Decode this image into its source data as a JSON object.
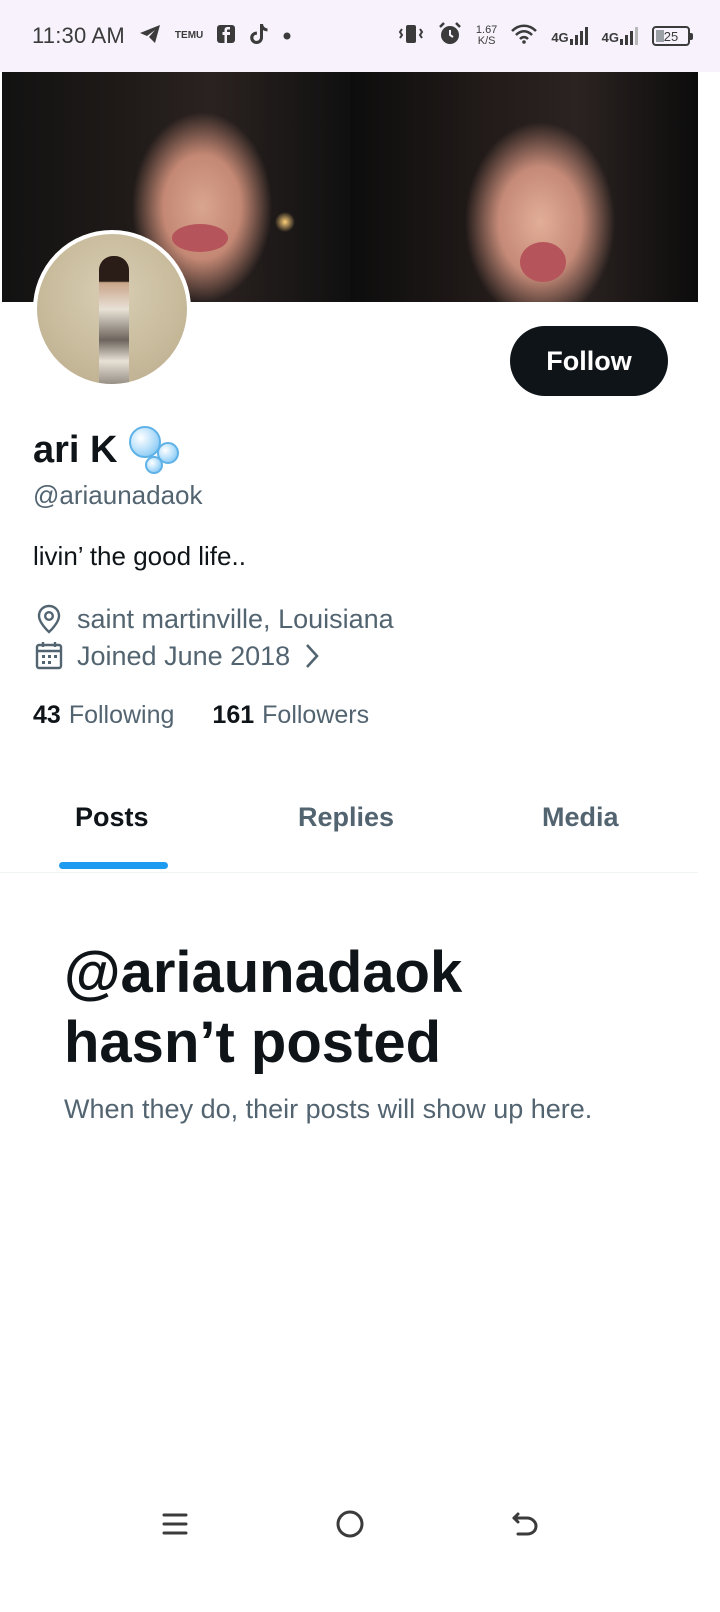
{
  "status_bar": {
    "time": "11:30 AM",
    "notification_icons": [
      "telegram-icon",
      "temu-icon",
      "facebook-icon",
      "tiktok-icon",
      "dot-icon"
    ],
    "temu_label": "TEMU",
    "net_speed_value": "1.67",
    "net_speed_unit": "K/S",
    "network_1": "4G",
    "network_2": "4G",
    "battery": "25"
  },
  "profile": {
    "display_name": "ari K",
    "emoji": "bubbles-emoji",
    "handle": "@ariaunadaok",
    "bio": "livin’ the good life..",
    "location": "saint martinville, Louisiana",
    "joined": "Joined June 2018",
    "following_count": "43",
    "following_label": "Following",
    "followers_count": "161",
    "followers_label": "Followers"
  },
  "actions": {
    "follow_label": "Follow"
  },
  "tabs": [
    {
      "label": "Posts",
      "active": true
    },
    {
      "label": "Replies",
      "active": false
    },
    {
      "label": "Media",
      "active": false
    }
  ],
  "empty_state": {
    "title_line1": "@ariaunadaok",
    "title_line2": "hasn’t posted",
    "subtitle": "When they do, their posts will show up here."
  },
  "colors": {
    "accent": "#1d9bf0",
    "primary_text": "#0f1419",
    "secondary_text": "#536471",
    "button_bg": "#0f1419"
  }
}
